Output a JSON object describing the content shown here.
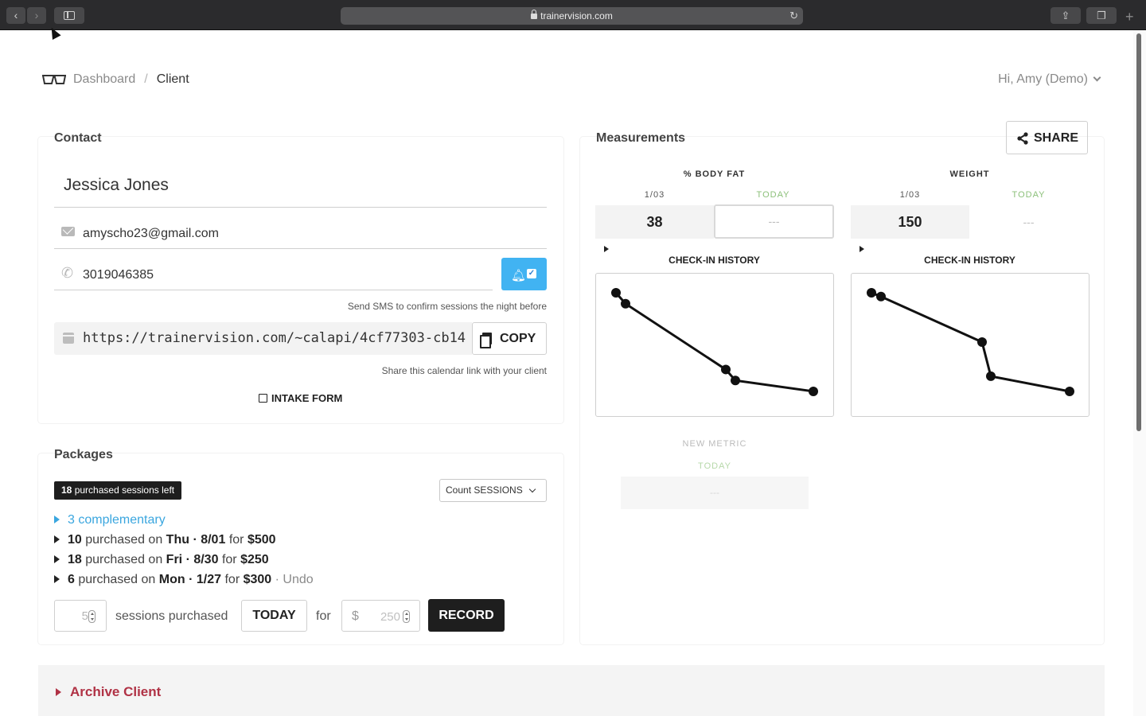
{
  "browser": {
    "url": "trainervision.com"
  },
  "header": {
    "breadcrumb_home": "Dashboard",
    "breadcrumb_sep": "/",
    "breadcrumb_current": "Client",
    "user_menu": "Hi, Amy (Demo)"
  },
  "contact": {
    "title": "Contact",
    "name": "Jessica Jones",
    "email": "amyscho23@gmail.com",
    "phone": "3019046385",
    "sms_hint": "Send SMS to confirm sessions the night before",
    "calendar_link": "https://trainervision.com/~calapi/4cf77303-cb14",
    "copy_label": "COPY",
    "calendar_hint": "Share this calendar link with your client",
    "intake_label": "INTAKE FORM"
  },
  "packages": {
    "title": "Packages",
    "badge_count": "18",
    "badge_text": "purchased sessions left",
    "count_select": "Count SESSIONS",
    "complementary": "3 complementary",
    "purchases": [
      {
        "count": "10",
        "mid": "purchased on",
        "day": "Thu · 8/01",
        "for": "for",
        "price": "$500",
        "undo": ""
      },
      {
        "count": "18",
        "mid": "purchased on",
        "day": "Fri · 8/30",
        "for": "for",
        "price": "$250",
        "undo": ""
      },
      {
        "count": "6",
        "mid": "purchased on",
        "day": "Mon · 1/27",
        "for": "for",
        "price": "$300",
        "undo": "· Undo"
      }
    ],
    "sessions_placeholder": "5",
    "sessions_label": "sessions purchased",
    "today_label": "TODAY",
    "for_label": "for",
    "currency": "$",
    "price_placeholder": "250",
    "record_label": "RECORD"
  },
  "archive": {
    "label": "Archive Client"
  },
  "measurements": {
    "title": "Measurements",
    "share_label": "SHARE",
    "metrics": [
      {
        "name": "% BODY FAT",
        "date_label": "1/03",
        "today_label": "TODAY",
        "last_value": "38",
        "today_value": "---",
        "history_label": "CHECK-IN HISTORY"
      },
      {
        "name": "WEIGHT",
        "date_label": "1/03",
        "today_label": "TODAY",
        "last_value": "150",
        "today_value": "---",
        "history_label": "CHECK-IN HISTORY"
      }
    ],
    "new_metric_label": "NEW METRIC",
    "new_metric_today": "TODAY",
    "new_metric_value": "---"
  },
  "colors": {
    "accent_blue": "#41b3f2",
    "archive_red": "#b03245",
    "today_green": "#8cc07a"
  },
  "chart_data": [
    {
      "type": "line",
      "series": [
        {
          "values": [
            40,
            39,
            33,
            32,
            31
          ]
        }
      ]
    },
    {
      "type": "line",
      "series": [
        {
          "values": [
            163,
            162,
            150,
            141,
            137
          ]
        }
      ]
    }
  ]
}
